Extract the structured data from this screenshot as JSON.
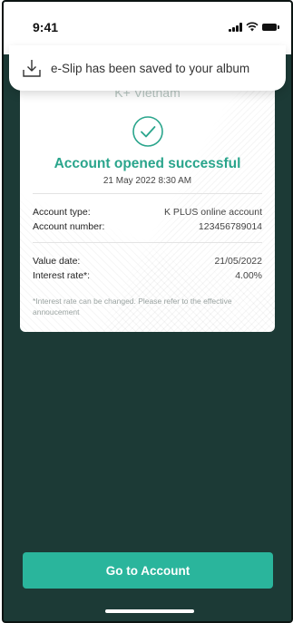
{
  "status_bar": {
    "time": "9:41"
  },
  "toast": {
    "icon": "download-icon",
    "message": "e-Slip has been saved to your album"
  },
  "slip": {
    "logo_text": "K+ Vietnam",
    "title": "Account opened successful",
    "datetime": "21 May 2022  8:30 AM",
    "account_type_label": "Account type:",
    "account_type_value": "K PLUS online account",
    "account_number_label": "Account number:",
    "account_number_value": "123456789014",
    "value_date_label": "Value date:",
    "value_date_value": "21/05/2022",
    "interest_rate_label": "Interest rate*:",
    "interest_rate_value": "4.00%",
    "note": "*Interest rate can be changed. Please refer to the effective annoucement"
  },
  "cta": {
    "label": "Go to Account"
  },
  "colors": {
    "accent": "#2ab59c",
    "title_green": "#2aa58c",
    "background": "#1c3a36"
  }
}
